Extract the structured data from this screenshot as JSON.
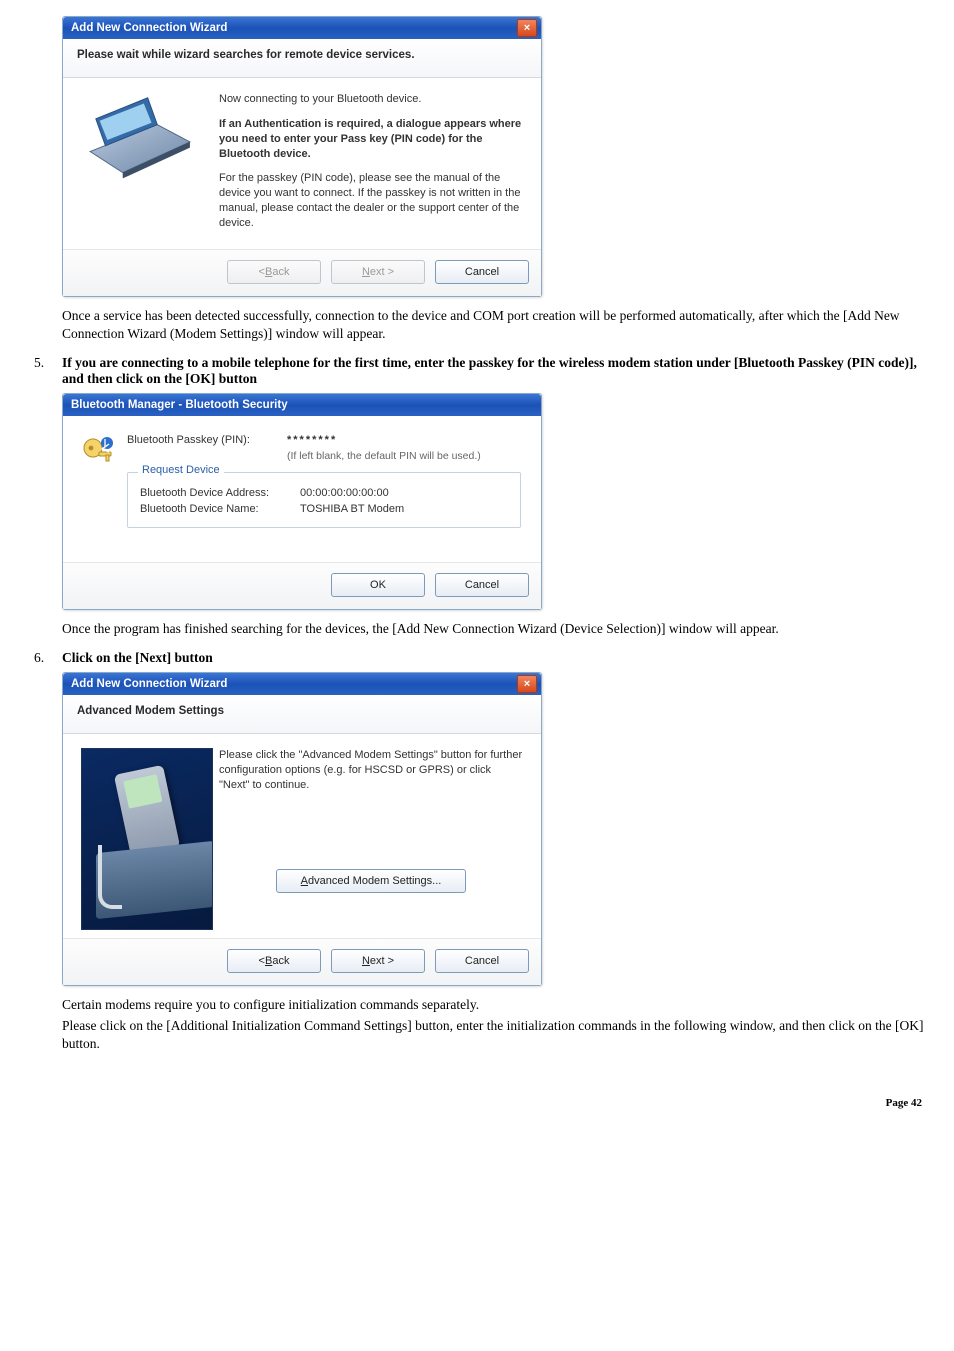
{
  "dialog1": {
    "title": "Add New Connection Wizard",
    "close": "×",
    "heading": "Please wait while wizard searches for remote device services.",
    "line1": "Now connecting to your Bluetooth device.",
    "line2": "If an Authentication is required, a dialogue appears where you need to enter your Pass key (PIN code) for the Bluetooth device.",
    "line3": "For the passkey (PIN code), please see the manual of the device you want to connect. If the passkey is not written in the manual, please contact the dealer or the support center of the device.",
    "back_pre": "< ",
    "back_u": "B",
    "back_post": "ack",
    "next_u": "N",
    "next_post": "ext >",
    "cancel": "Cancel"
  },
  "para1": "Once a service has been detected successfully, connection to the device and COM port creation will be performed automatically, after which the [Add New Connection Wizard (Modem Settings)] window will appear.",
  "step5": {
    "num": "5.",
    "text": "If you are connecting to a mobile telephone for the first time, enter the passkey for the wireless modem station under [Bluetooth Passkey (PIN code)], and then click on the [OK] button"
  },
  "dialog2": {
    "title": "Bluetooth Manager - Bluetooth Security",
    "passkey_label": "Bluetooth Passkey (PIN):",
    "passkey_mask": "********",
    "passkey_sub": "(If left blank, the default PIN will be used.)",
    "fieldset_legend": "Request Device",
    "addr_label": "Bluetooth Device Address:",
    "addr_value": "00:00:00:00:00:00",
    "name_label": "Bluetooth Device Name:",
    "name_value": "TOSHIBA BT Modem",
    "ok": "OK",
    "cancel": "Cancel"
  },
  "para2": "Once the program has finished searching for the devices, the [Add New Connection Wizard (Device Selection)] window will appear.",
  "step6": {
    "num": "6.",
    "text": "Click on the [Next] button"
  },
  "dialog3": {
    "title": "Add New Connection Wizard",
    "close": "×",
    "heading": "Advanced Modem Settings",
    "body": "Please click the \"Advanced Modem Settings\" button for further configuration options (e.g. for HSCSD or GPRS) or click \"Next\" to continue.",
    "adv_u": "A",
    "adv_post": "dvanced Modem Settings...",
    "back_pre": "< ",
    "back_u": "B",
    "back_post": "ack",
    "next_u": "N",
    "next_post": "ext >",
    "cancel": "Cancel"
  },
  "para3a": "Certain modems require you to configure initialization commands separately.",
  "para3b": "Please click on the [Additional Initialization Command Settings] button, enter the initialization commands in the following window, and then click on the [OK] button.",
  "page_num": "Page 42"
}
